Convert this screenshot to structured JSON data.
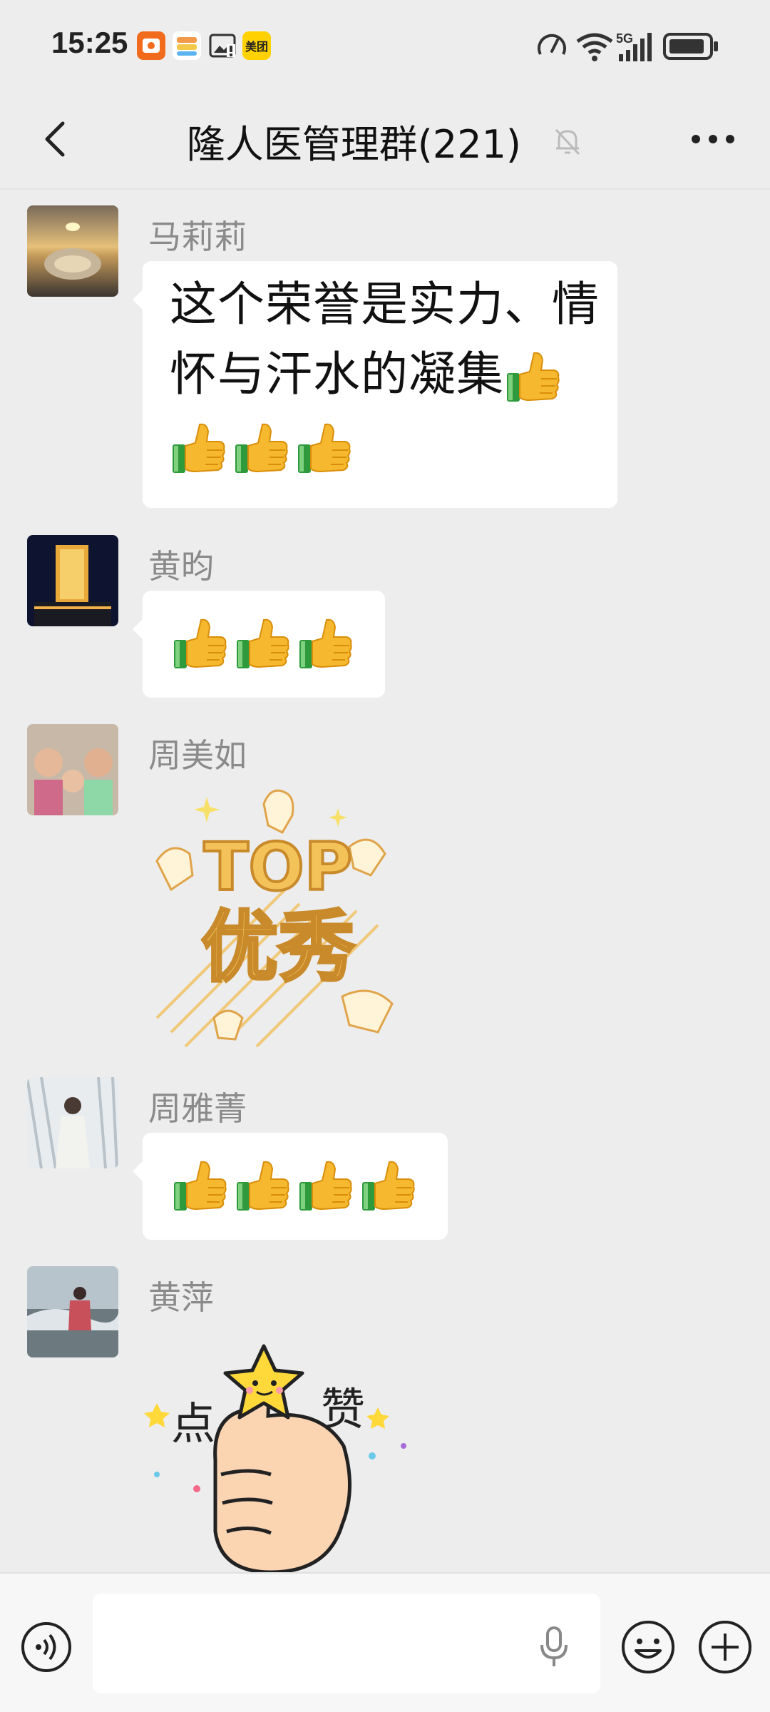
{
  "status": {
    "time": "15:25",
    "app_icons": [
      "app-badge-icon",
      "cloud-app-icon",
      "image-alert-icon",
      "meituan-icon"
    ],
    "meituan_label": "美团",
    "network": "5G",
    "right_icons": [
      "speed-icon",
      "wifi-icon",
      "signal-icon",
      "battery-icon"
    ]
  },
  "header": {
    "back_icon": "chevron-left-icon",
    "title": "隆人医管理群(221)",
    "mute_icon": "bell-off-icon",
    "more_icon": "more-dots-icon"
  },
  "messages": [
    {
      "sender": "马莉莉",
      "type": "text",
      "lines": [
        "这个荣誉是实力、情",
        "怀与汗水的凝集"
      ],
      "thumbs_after_line2": 1,
      "thumbs_line3": 3,
      "avatar": "sunset-water-avatar"
    },
    {
      "sender": "黄昀",
      "type": "emoji",
      "thumbs": 3,
      "avatar": "night-building-avatar"
    },
    {
      "sender": "周美如",
      "type": "sticker",
      "sticker": "top-youxiu-sticker",
      "sticker_text_top": "TOP",
      "sticker_text_bottom": "优秀",
      "avatar": "family-photo-avatar"
    },
    {
      "sender": "周雅菁",
      "type": "emoji",
      "thumbs": 4,
      "avatar": "snow-forest-avatar"
    },
    {
      "sender": "黄萍",
      "type": "sticker",
      "sticker": "thumbs-up-star-sticker",
      "sticker_text_left": "点",
      "sticker_text_right": "赞",
      "avatar": "cloudy-mountain-avatar"
    }
  ],
  "input": {
    "voice_icon": "voice-toggle-icon",
    "mic_icon": "microphone-icon",
    "emoji_icon": "emoji-icon",
    "plus_icon": "plus-icon",
    "value": ""
  },
  "colors": {
    "background": "#ededed",
    "bubble": "#ffffff",
    "sender_name": "#8a8a8a",
    "thumb_yellow": "#f5b82e",
    "sleeve_green": "#2f9a3c"
  }
}
